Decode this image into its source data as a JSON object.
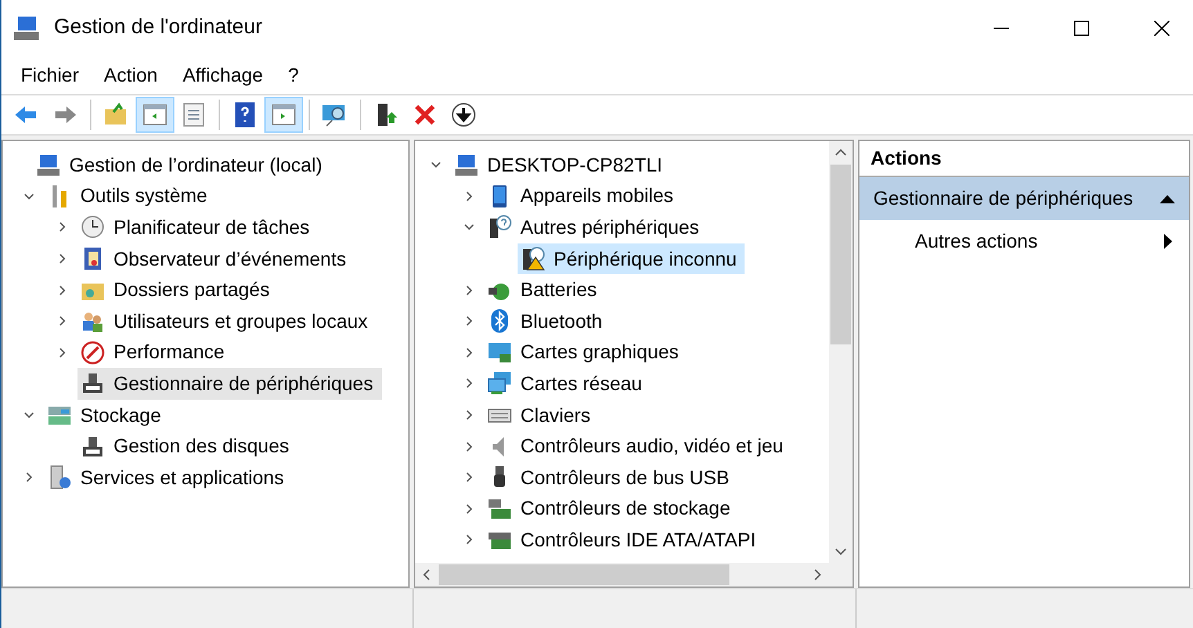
{
  "window": {
    "title": "Gestion de l'ordinateur"
  },
  "menu": [
    {
      "label": "Fichier"
    },
    {
      "label": "Action"
    },
    {
      "label": "Affichage"
    },
    {
      "label": "?"
    }
  ],
  "toolbar": [
    {
      "pressed": false
    },
    {
      "pressed": false
    },
    {
      "pressed": false
    },
    {
      "pressed": true
    },
    {
      "pressed": false
    },
    {
      "pressed": false
    },
    {
      "pressed": true
    },
    {
      "pressed": false
    },
    {
      "pressed": false
    },
    {
      "pressed": false
    },
    {
      "pressed": false
    }
  ],
  "console_tree": [
    {
      "label": "Gestion de l’ordinateur (local)",
      "selected": false,
      "kind": "root",
      "children": [
        {
          "label": "Outils système",
          "selected": false,
          "expanded": true,
          "children": [
            {
              "label": "Planificateur de tâches",
              "selected": false,
              "expanded": false
            },
            {
              "label": "Observateur d’événements",
              "selected": false,
              "expanded": false
            },
            {
              "label": "Dossiers partagés",
              "selected": false,
              "expanded": false
            },
            {
              "label": "Utilisateurs et groupes locaux",
              "selected": false,
              "expanded": false
            },
            {
              "label": "Performance",
              "selected": false,
              "expanded": false
            },
            {
              "label": "Gestionnaire de périphériques",
              "selected": true,
              "kind": "leaf"
            }
          ]
        },
        {
          "label": "Stockage",
          "selected": false,
          "expanded": true,
          "children": [
            {
              "label": "Gestion des disques",
              "selected": false,
              "kind": "leaf"
            }
          ]
        },
        {
          "label": "Services et applications",
          "selected": false,
          "expanded": false
        }
      ]
    }
  ],
  "device_tree": [
    {
      "label": "DESKTOP-CP82TLI",
      "selected": false,
      "expanded": true,
      "children": [
        {
          "label": "Appareils mobiles",
          "selected": false,
          "expanded": false
        },
        {
          "label": "Autres périphériques",
          "selected": false,
          "expanded": true,
          "children": [
            {
              "label": "Périphérique inconnu",
              "selected": true,
              "kind": "leaf"
            }
          ]
        },
        {
          "label": "Batteries",
          "selected": false,
          "expanded": false
        },
        {
          "label": "Bluetooth",
          "selected": false,
          "expanded": false
        },
        {
          "label": "Cartes graphiques",
          "selected": false,
          "expanded": false
        },
        {
          "label": "Cartes réseau",
          "selected": false,
          "expanded": false
        },
        {
          "label": "Claviers",
          "selected": false,
          "expanded": false
        },
        {
          "label": "Contrôleurs audio, vidéo et jeu",
          "selected": false,
          "expanded": false
        },
        {
          "label": "Contrôleurs de bus USB",
          "selected": false,
          "expanded": false
        },
        {
          "label": "Contrôleurs de stockage",
          "selected": false,
          "expanded": false
        },
        {
          "label": "Contrôleurs IDE ATA/ATAPI",
          "selected": false,
          "expanded": false
        }
      ]
    }
  ],
  "actions": {
    "title": "Actions",
    "sections": [
      {
        "label": "Gestionnaire de périphériques",
        "expanded": true,
        "items": [
          {
            "label": "Autres actions"
          }
        ]
      }
    ]
  }
}
